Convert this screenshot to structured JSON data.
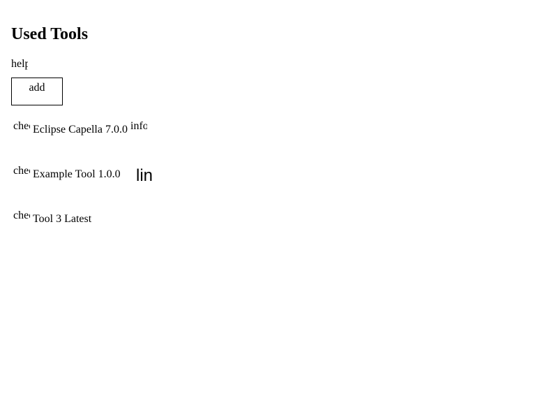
{
  "header": {
    "title": "Used Tools"
  },
  "toolbar": {
    "help_icon_text": "help",
    "add_label": "add"
  },
  "tools": [
    {
      "check_icon_text": "check",
      "name": "Eclipse Capella 7.0.0",
      "action_icon": "info-icon",
      "action_icon_text": "info"
    },
    {
      "check_icon_text": "check",
      "name": "Example Tool 1.0.0",
      "action_icon": "link-icon",
      "action_icon_text": "link"
    },
    {
      "check_icon_text": "check",
      "name": "Tool 3 Latest"
    }
  ]
}
